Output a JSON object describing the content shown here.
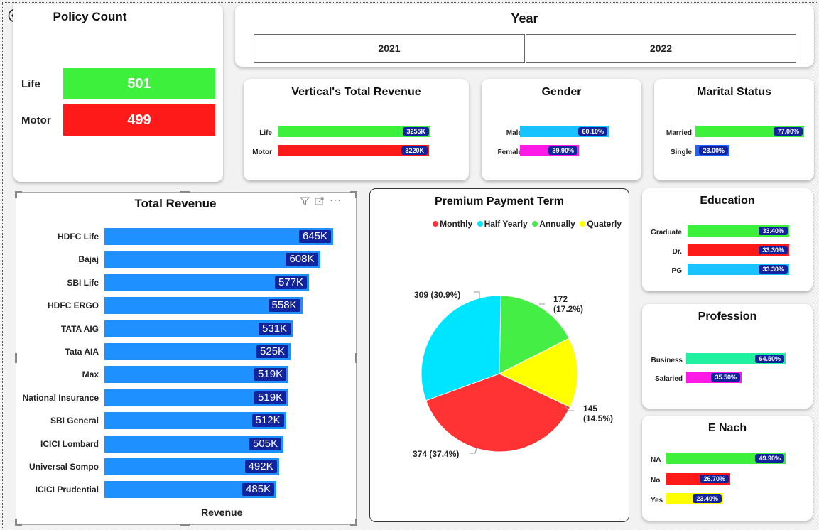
{
  "policy_count": {
    "title": "Policy Count",
    "items": [
      {
        "label": "Life",
        "value": "501",
        "color": "#3cf03c"
      },
      {
        "label": "Motor",
        "value": "499",
        "color": "#ff1a1a"
      }
    ]
  },
  "year": {
    "title": "Year",
    "options": [
      "2021",
      "2022"
    ]
  },
  "vertical_revenue": {
    "title": "Vertical's Total Revenue",
    "items": [
      {
        "label": "Life",
        "value": "3255K",
        "fraction": 1.0,
        "color": "#3cf03c"
      },
      {
        "label": "Motor",
        "value": "3220K",
        "fraction": 0.989,
        "color": "#ff1a1a"
      }
    ]
  },
  "gender": {
    "title": "Gender",
    "items": [
      {
        "label": "Male",
        "value": "60.10%",
        "fraction": 1.0,
        "color": "#19c3ff"
      },
      {
        "label": "Female",
        "value": "39.90%",
        "fraction": 0.664,
        "color": "#ff19e6"
      }
    ]
  },
  "marital": {
    "title": "Marital Status",
    "items": [
      {
        "label": "Married",
        "value": "77.00%",
        "fraction": 1.0,
        "color": "#3cf03c"
      },
      {
        "label": "Single",
        "value": "23.00%",
        "fraction": 0.3,
        "color": "#1e64ff"
      }
    ]
  },
  "total_revenue": {
    "title": "Total Revenue",
    "xlabel": "Revenue",
    "chart_data": {
      "type": "bar",
      "title": "Total Revenue",
      "xlabel": "Revenue",
      "categories": [
        "HDFC Life",
        "Bajaj",
        "SBI Life",
        "HDFC ERGO",
        "TATA AIG",
        "Tata AIA",
        "Max",
        "National Insurance",
        "SBI General",
        "ICICI Lombard",
        "Universal Sompo",
        "ICICI Prudential"
      ],
      "values": [
        645,
        608,
        577,
        558,
        531,
        525,
        519,
        519,
        512,
        505,
        492,
        485
      ],
      "labels": [
        "645K",
        "608K",
        "577K",
        "558K",
        "531K",
        "525K",
        "519K",
        "519K",
        "512K",
        "505K",
        "492K",
        "485K"
      ]
    },
    "icons": [
      "filter-icon",
      "focus-mode-icon",
      "more-options-icon"
    ]
  },
  "premium": {
    "title": "Premium Payment Term",
    "chart_data": {
      "type": "pie",
      "title": "Premium Payment Term",
      "series": [
        {
          "name": "Monthly",
          "value": 374,
          "label": "374 (37.4%)",
          "color": "#ff3333"
        },
        {
          "name": "Half Yearly",
          "value": 309,
          "label": "309 (30.9%)",
          "color": "#00e5ff"
        },
        {
          "name": "Annually",
          "value": 172,
          "label": "172 (17.2%)",
          "color": "#44ee44"
        },
        {
          "name": "Quaterly",
          "value": 145,
          "label": "145 (14.5%)",
          "color": "#ffff00"
        }
      ]
    },
    "label_text": {
      "s0": "374 (37.4%)",
      "s1": "309 (30.9%)",
      "s2a": "172",
      "s2b": "(17.2%)",
      "s3a": "145",
      "s3b": "(14.5%)"
    }
  },
  "education": {
    "title": "Education",
    "items": [
      {
        "label": "Graduate",
        "value": "33.40%",
        "fraction": 1.0,
        "color": "#3cf03c"
      },
      {
        "label": "Dr.",
        "value": "33.30%",
        "fraction": 1.0,
        "color": "#ff1a1a"
      },
      {
        "label": "PG",
        "value": "33.30%",
        "fraction": 1.0,
        "color": "#19c3ff"
      }
    ]
  },
  "profession": {
    "title": "Profession",
    "items": [
      {
        "label": "Business",
        "value": "64.50%",
        "fraction": 1.0,
        "color": "#21f0a0"
      },
      {
        "label": "Salaried",
        "value": "35.50%",
        "fraction": 0.55,
        "color": "#ff19e6"
      }
    ]
  },
  "enach": {
    "title": "E Nach",
    "items": [
      {
        "label": "NA",
        "value": "49.90%",
        "fraction": 1.0,
        "color": "#3cf03c"
      },
      {
        "label": "No",
        "value": "26.70%",
        "fraction": 0.535,
        "color": "#ff1a1a"
      },
      {
        "label": "Yes",
        "value": "23.40%",
        "fraction": 0.469,
        "color": "#ffff00"
      }
    ]
  },
  "nav": {
    "back_icon": "back-arrow-icon"
  }
}
